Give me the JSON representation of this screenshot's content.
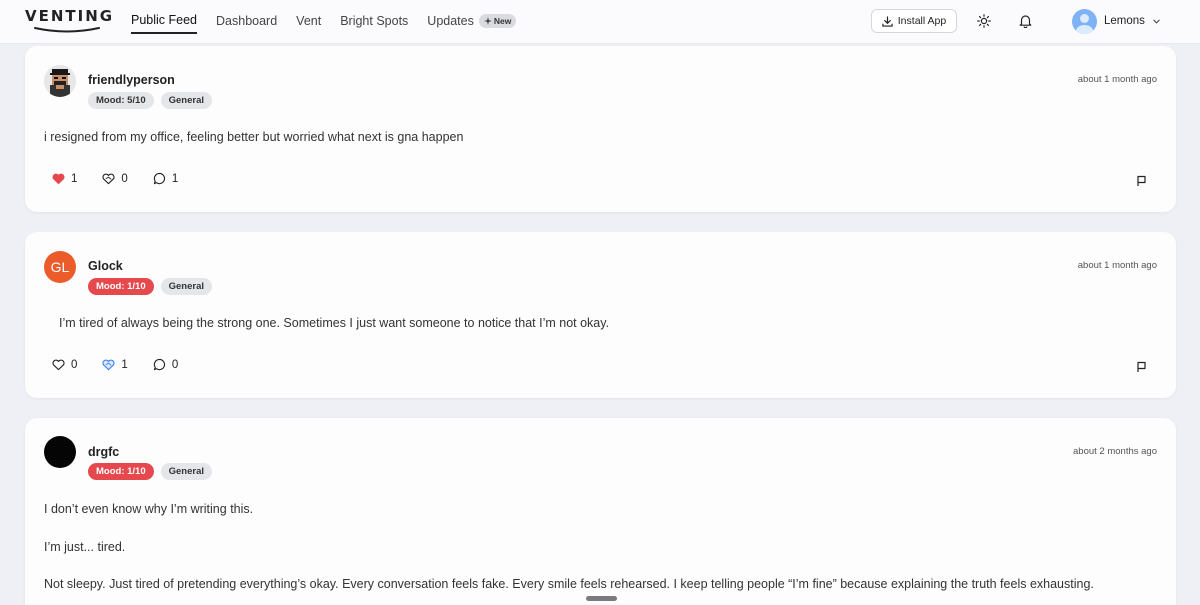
{
  "app": {
    "logo_text": "VENTING",
    "nav": [
      {
        "label": "Public Feed",
        "active": true
      },
      {
        "label": "Dashboard",
        "active": false
      },
      {
        "label": "Vent",
        "active": false
      },
      {
        "label": "Bright Spots",
        "active": false
      },
      {
        "label": "Updates",
        "active": false
      }
    ],
    "updates_badge": "New",
    "install_label": "Install App",
    "user_name": "Lemons"
  },
  "posts": [
    {
      "username": "friendlyperson",
      "mood": "Mood: 5/10",
      "category": "General",
      "time": "about 1 month ago",
      "text": [
        "i resigned from my office, feeling better but worried what next is gna happen"
      ],
      "likes": "1",
      "hugs": "0",
      "comments": "1"
    },
    {
      "username": "Glock",
      "initials": "GL",
      "mood": "Mood: 1/10",
      "category": "General",
      "time": "about 1 month ago",
      "text": [
        "I’m tired of always being the strong one. Sometimes I just want someone to notice that I’m not okay."
      ],
      "likes": "0",
      "hugs": "1",
      "comments": "0"
    },
    {
      "username": "drgfc",
      "mood": "Mood: 1/10",
      "category": "General",
      "time": "about 2 months ago",
      "text": [
        "I don’t even know why I’m writing this.",
        "I’m just... tired.",
        "Not sleepy. Just tired of pretending everything’s okay. Every conversation feels fake. Every smile feels rehearsed. I keep telling people “I’m fine” because explaining the truth feels exhausting."
      ]
    }
  ],
  "colors": {
    "mood_low": "#e5484d",
    "heart_filled": "#e5484d",
    "hug_active": "#3b82f6",
    "initials_avatar": "#ec5b2a"
  }
}
